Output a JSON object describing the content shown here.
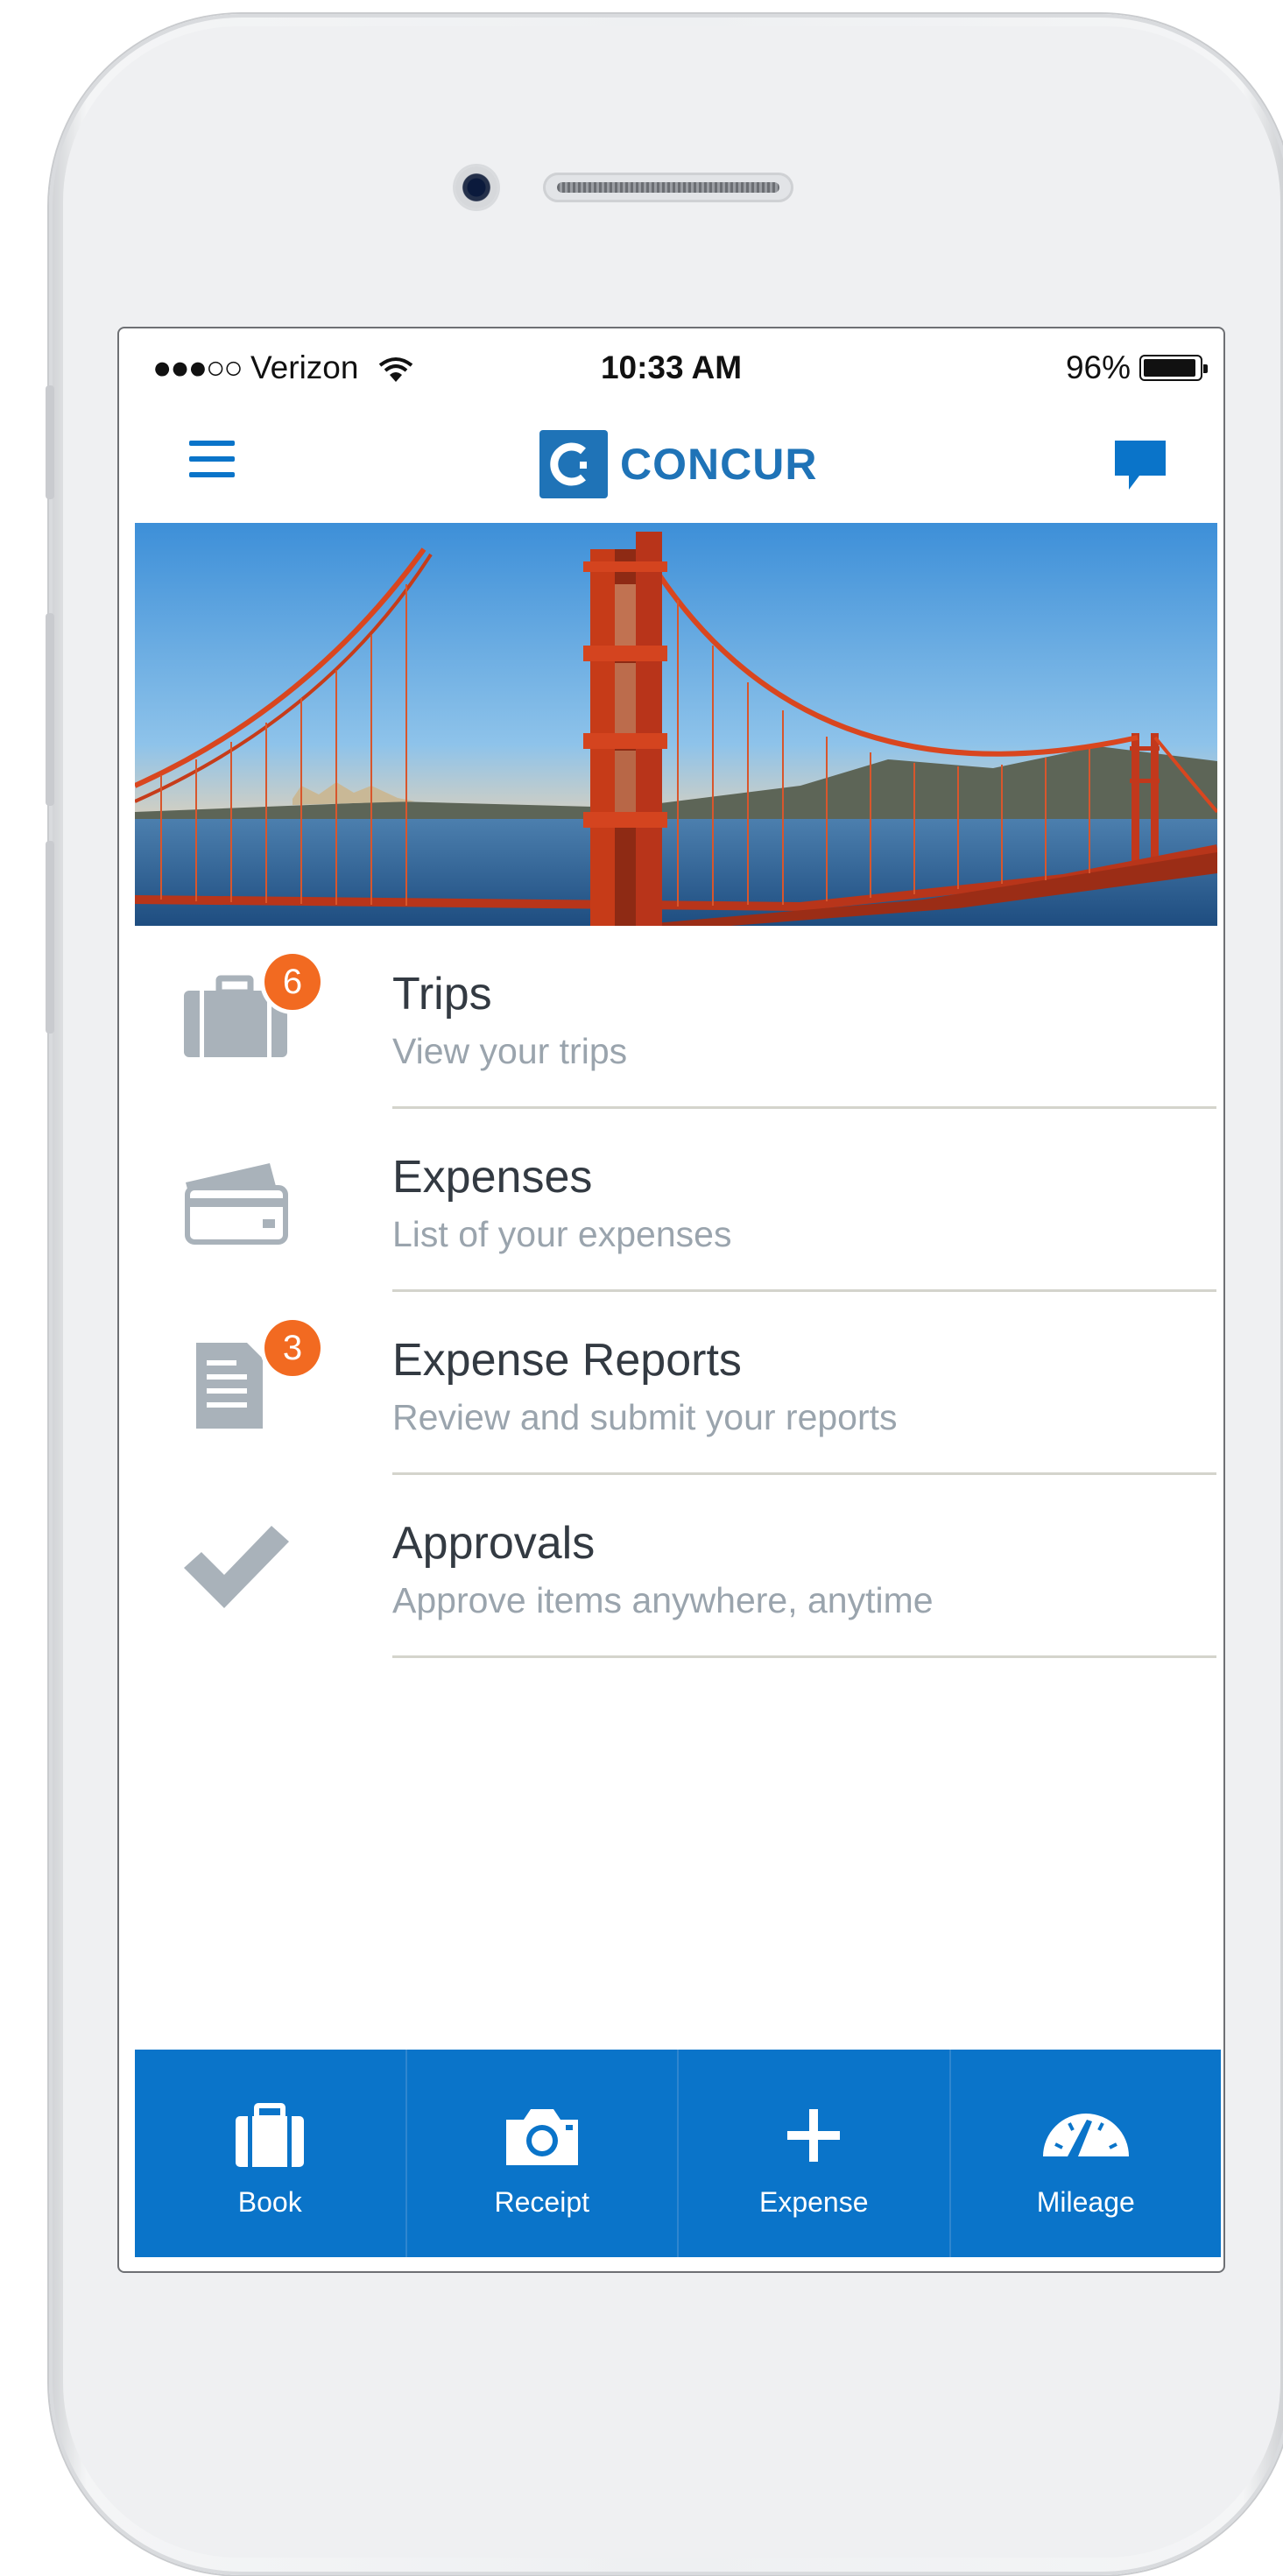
{
  "status_bar": {
    "signal": "●●●○○",
    "carrier": "Verizon",
    "time": "10:33 AM",
    "battery_percent": "96%",
    "battery_level": 0.96
  },
  "header": {
    "logo_text": "CONCUR",
    "menu_icon": "hamburger-menu-icon",
    "chat_icon": "chat-bubble-icon"
  },
  "menu": [
    {
      "title": "Trips",
      "subtitle": "View your trips",
      "icon": "briefcase-icon",
      "badge": "6"
    },
    {
      "title": "Expenses",
      "subtitle": "List of your expenses",
      "icon": "credit-card-icon",
      "badge": ""
    },
    {
      "title": "Expense Reports",
      "subtitle": "Review and submit your reports",
      "icon": "report-icon",
      "badge": "3"
    },
    {
      "title": "Approvals",
      "subtitle": "Approve items anywhere, anytime",
      "icon": "checkmark-icon",
      "badge": ""
    }
  ],
  "tabs": [
    {
      "label": "Book",
      "icon": "briefcase-icon"
    },
    {
      "label": "Receipt",
      "icon": "camera-icon"
    },
    {
      "label": "Expense",
      "icon": "plus-icon"
    },
    {
      "label": "Mileage",
      "icon": "speedometer-icon"
    }
  ],
  "colors": {
    "brand_blue": "#0a74c9",
    "badge_orange": "#f26a21",
    "title_text": "#333a42",
    "subtitle_text": "#9aa4ad",
    "icon_gray": "#a9b2ba"
  }
}
